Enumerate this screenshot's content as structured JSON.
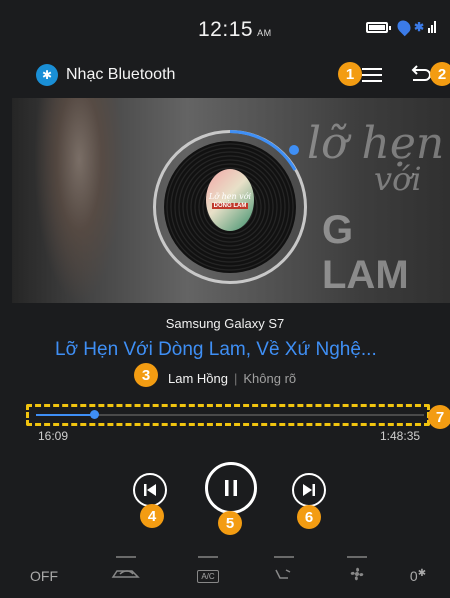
{
  "status_bar": {
    "time": "12:15",
    "ampm": "AM",
    "bluetooth_glyph": "✱"
  },
  "header": {
    "bt_glyph": "✱",
    "title": "Nhạc Bluetooth"
  },
  "banner": {
    "watermark_line1": "lỡ hẹn",
    "watermark_line2": "với",
    "watermark_line3": "G LAM",
    "cover_line1": "Lỡ hẹn với",
    "cover_line2": "DÒNG LAM"
  },
  "player": {
    "device": "Samsung Galaxy S7",
    "song_title": "Lỡ Hẹn Với Dòng Lam, Về Xứ Nghệ...",
    "artist": "Lam Hồng",
    "separator": "|",
    "album": "Không rõ",
    "elapsed": "16:09",
    "duration": "1:48:35",
    "progress_fraction": 0.149
  },
  "annotations": [
    "1",
    "2",
    "3",
    "4",
    "5",
    "6",
    "7"
  ],
  "climate": {
    "power_label": "OFF",
    "ac_label": "A/C",
    "fan_level": "0"
  },
  "colors": {
    "accent_blue": "#3f8ff5",
    "marker_orange": "#f39c12",
    "highlight_yellow": "#f1c40f",
    "background": "#1b1c1e"
  }
}
